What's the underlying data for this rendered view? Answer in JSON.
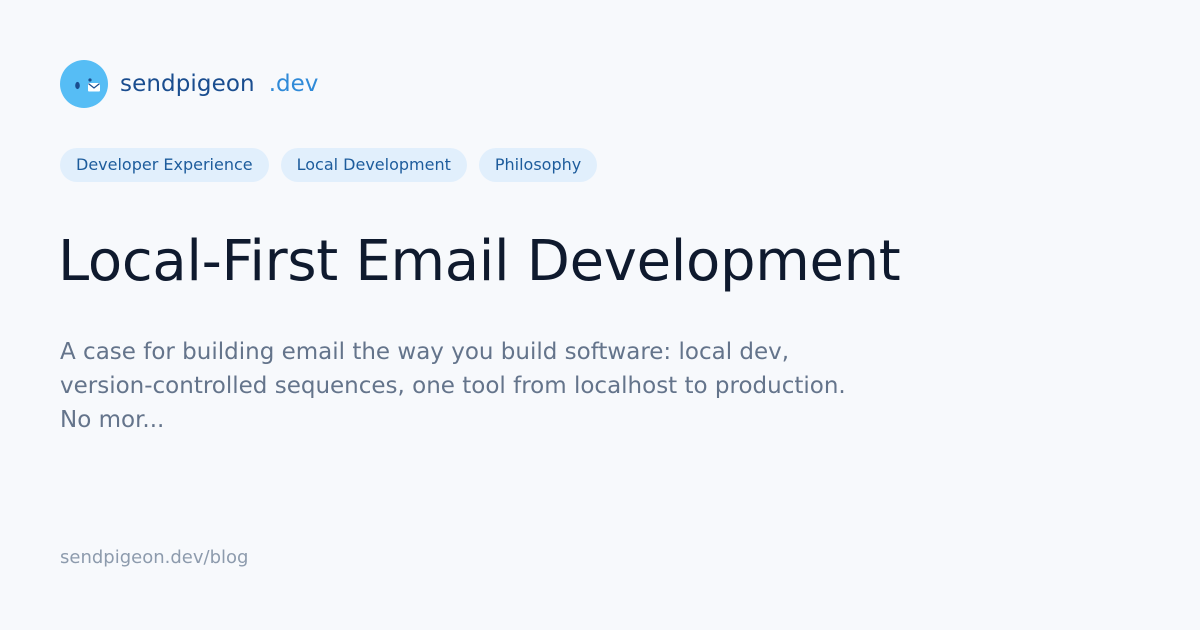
{
  "brand": {
    "name": "sendpigeon",
    "tld": ".dev",
    "logo_icon": "pigeon-mail-icon",
    "logo_color": "#56bdf5"
  },
  "tags": [
    "Developer Experience",
    "Local Development",
    "Philosophy"
  ],
  "title": "Local-First Email Development",
  "description": "A case for building email the way you build software: local dev, version-controlled sequences, one tool from localhost to production. No mor...",
  "footer": {
    "url": "sendpigeon.dev/blog"
  },
  "colors": {
    "background": "#f7f9fc",
    "tag_background": "#e1effc",
    "tag_text": "#1d5c9c",
    "title": "#0f1a2e",
    "description": "#64748b",
    "brand_name": "#1a4d8f",
    "brand_tld": "#2f8ad8"
  }
}
